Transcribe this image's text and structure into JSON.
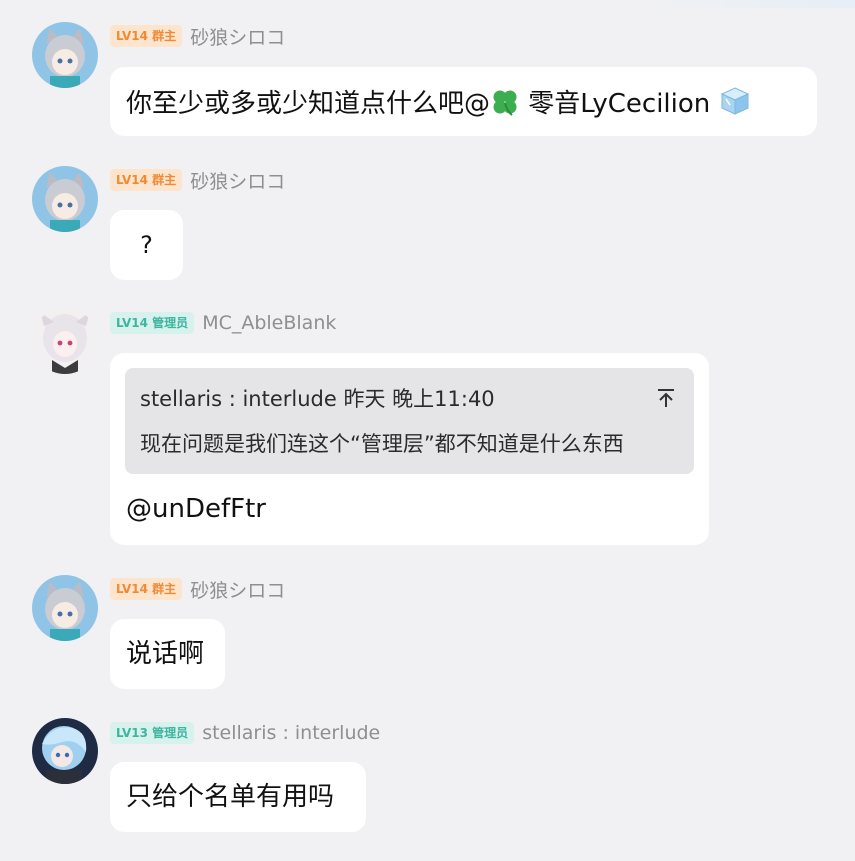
{
  "messages": [
    {
      "avatar": "anime-cat-girl-avatar",
      "level": "LV14",
      "role": "群主",
      "nickname": "砂狼シロコ",
      "text_before": "你至少或多或少知道点什么吧@",
      "mention_icon": "four-leaf-clover-icon",
      "text_mention": " 零音LyCecilion ",
      "trailing_icon": "ice-cube-icon"
    },
    {
      "avatar": "anime-cat-girl-avatar",
      "level": "LV14",
      "role": "群主",
      "nickname": "砂狼シロコ",
      "text": "?"
    },
    {
      "avatar": "white-haired-girl-avatar",
      "level": "LV14",
      "role": "管理员",
      "nickname": "MC_AbleBlank",
      "quote": {
        "header": "stellaris : interlude 昨天 晚上11:40",
        "body": "现在问题是我们连这个“管理层”都不知道是什么东西",
        "icon": "scroll-to-top-icon"
      },
      "text": "@unDefFtr"
    },
    {
      "avatar": "anime-cat-girl-avatar",
      "level": "LV14",
      "role": "群主",
      "nickname": "砂狼シロコ",
      "text": "说话啊"
    },
    {
      "avatar": "blue-haired-character-avatar",
      "level": "LV13",
      "role": "管理员",
      "nickname": "stellaris : interlude",
      "text": "只给个名单有用吗"
    }
  ],
  "colors": {
    "background": "#f1f1f3",
    "bubble": "#ffffff",
    "owner_badge_bg": "#fde5cd",
    "owner_badge_text": "#f08a35",
    "admin_badge_bg": "#d7f2ec",
    "admin_badge_text": "#3fb5a0"
  }
}
